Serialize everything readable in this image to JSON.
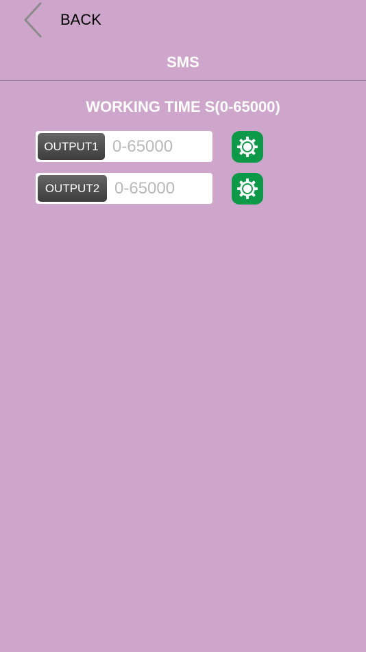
{
  "header": {
    "back_label": "BACK",
    "title": "SMS"
  },
  "section": {
    "heading": "WORKING TIME S(0-65000)"
  },
  "outputs": [
    {
      "label": "OUTPUT1",
      "placeholder": "0-65000",
      "value": ""
    },
    {
      "label": "OUTPUT2",
      "placeholder": "0-65000",
      "value": ""
    }
  ],
  "icons": {
    "back": "chevron-left-icon",
    "settings": "gear-icon"
  },
  "colors": {
    "background": "#cea6cb",
    "settings_button": "#0c9a48",
    "label_pill": "#4a4a4a",
    "title_text": "#ffffff"
  }
}
